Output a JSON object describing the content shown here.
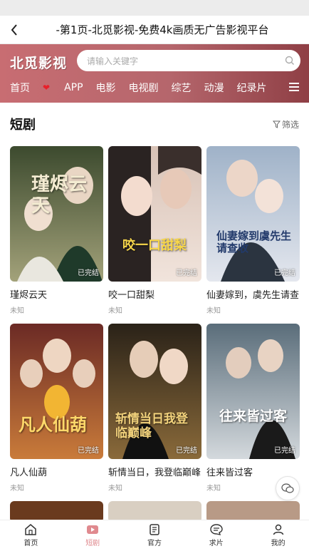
{
  "topbar": {
    "title": "-第1页-北觅影视-免费4k画质无广告影视平台"
  },
  "header": {
    "logo": "北觅影视",
    "search_placeholder": "请输入关键字",
    "nav": [
      {
        "label": "首页"
      },
      {
        "label": "APP"
      },
      {
        "label": "电影"
      },
      {
        "label": "电视剧"
      },
      {
        "label": "综艺"
      },
      {
        "label": "动漫"
      },
      {
        "label": "纪录片"
      }
    ]
  },
  "section": {
    "title": "短剧",
    "filter_label": "筛选"
  },
  "cards": [
    {
      "title": "瑾烬云天",
      "sub": "未知",
      "badge": "已完结",
      "poster_text": "瑾烬云天",
      "colors": [
        "#3c4a2e",
        "#a3a27a"
      ]
    },
    {
      "title": "咬一口甜梨",
      "sub": "未知",
      "badge": "已完结",
      "poster_text": "咬一口甜梨",
      "colors": [
        "#d8c2b6",
        "#f1e4dc"
      ]
    },
    {
      "title": "仙妻嫁到，虞先生请查收",
      "sub": "未知",
      "badge": "已完结",
      "poster_text": "仙妻嫁到虞先生请查收",
      "colors": [
        "#9fb2c8",
        "#e4e7ee"
      ]
    },
    {
      "title": "凡人仙葫",
      "sub": "未知",
      "badge": "已完结",
      "poster_text": "凡人仙葫",
      "colors": [
        "#6b2a25",
        "#c97b3a"
      ]
    },
    {
      "title": "斩情当日，我登临巅峰",
      "sub": "未知",
      "badge": "已完结",
      "poster_text": "斩情当日我登临巅峰",
      "colors": [
        "#2a2218",
        "#8a6a3a"
      ]
    },
    {
      "title": "往来皆过客",
      "sub": "未知",
      "badge": "已完结",
      "poster_text": "往来皆过客",
      "colors": [
        "#5a6d7a",
        "#d4d9dd"
      ]
    }
  ],
  "tabbar": [
    {
      "label": "首页",
      "active": false
    },
    {
      "label": "短剧",
      "active": true
    },
    {
      "label": "官方",
      "active": false
    },
    {
      "label": "求片",
      "active": false
    },
    {
      "label": "我的",
      "active": false
    }
  ],
  "colors": {
    "accent": "#e08a8f",
    "header": "#b5666c",
    "nav_heart": "#e8202a"
  },
  "icons": [
    "back-arrow-icon",
    "search-icon",
    "heart-icon",
    "menu-icon",
    "filter-icon",
    "wechat-icon",
    "home-icon",
    "video-icon",
    "document-icon",
    "chat-icon",
    "user-icon"
  ]
}
